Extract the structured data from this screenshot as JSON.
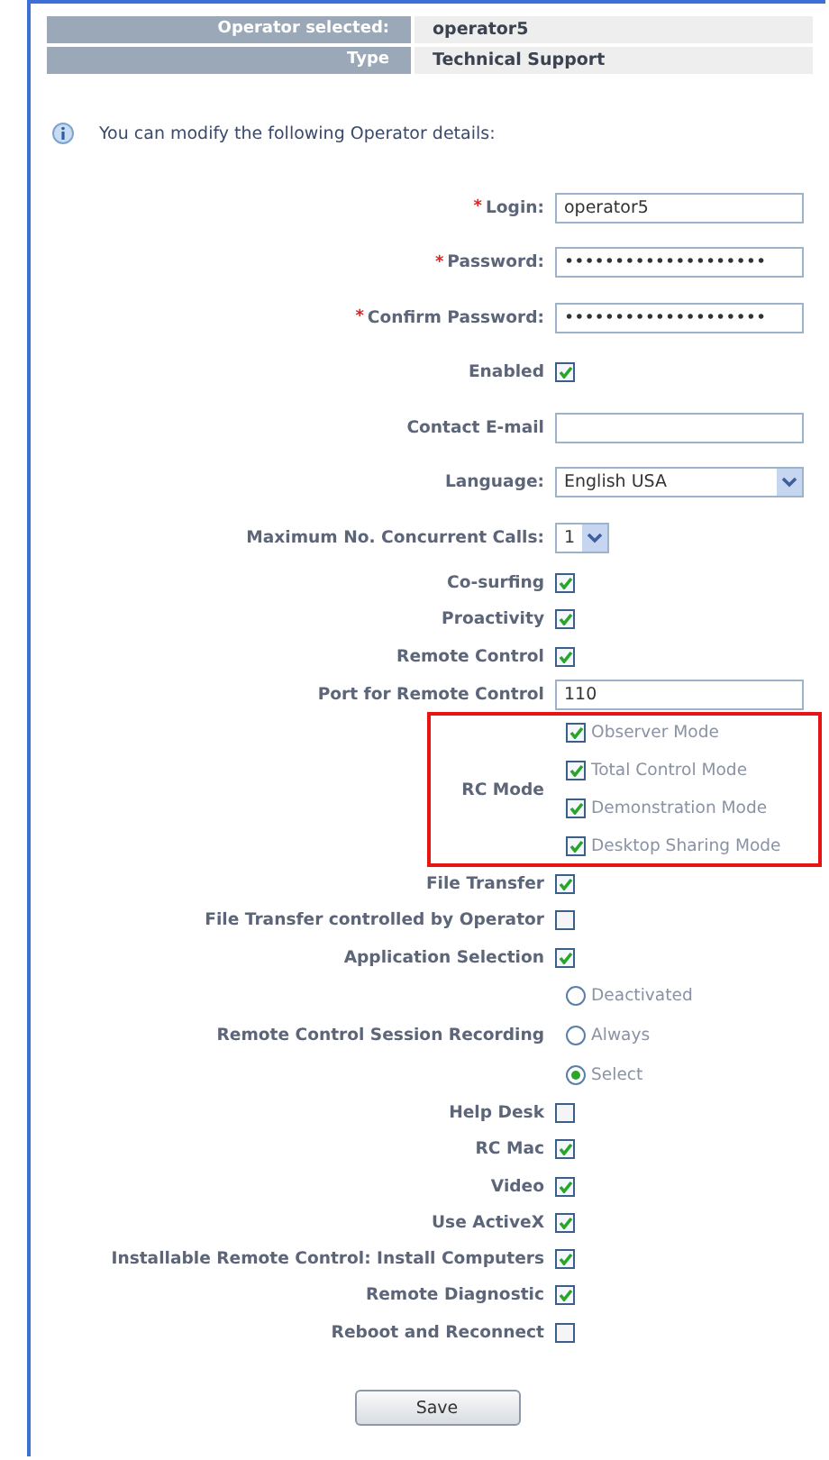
{
  "header": [
    {
      "label": "Operator selected:",
      "value": "operator5"
    },
    {
      "label": "Type",
      "value": "Technical Support"
    }
  ],
  "info": "You can modify the following Operator details:",
  "account_fields": [
    {
      "kind": "text",
      "required_mark": "*",
      "label": "Login:",
      "value": "operator5"
    },
    {
      "kind": "text",
      "required_mark": "*",
      "label": "Password:",
      "value": "••••••••••••••••••••"
    },
    {
      "kind": "text",
      "required_mark": "*",
      "label": "Confirm Password:",
      "value": "••••••••••••••••••••"
    },
    {
      "kind": "checkbox",
      "label": "Enabled",
      "checked": true
    },
    {
      "kind": "text",
      "label": "Contact E-mail"
    },
    {
      "kind": "select",
      "label": "Language:",
      "value": "English USA",
      "wide": true
    },
    {
      "kind": "select",
      "label": "Maximum No. Concurrent Calls:",
      "value": "1",
      "wide": false
    }
  ],
  "features": [
    {
      "kind": "checkbox",
      "label": "Co-surfing",
      "checked": true
    },
    {
      "kind": "checkbox",
      "label": "Proactivity",
      "checked": true
    },
    {
      "kind": "checkbox",
      "label": "Remote Control",
      "checked": true
    },
    {
      "kind": "text",
      "label": "Port for Remote Control",
      "value": "110"
    },
    {
      "kind": "checkgroup",
      "label": "RC Mode",
      "highlighted": true,
      "options": [
        {
          "label": "Observer Mode",
          "checked": true
        },
        {
          "label": "Total Control Mode",
          "checked": true
        },
        {
          "label": "Demonstration Mode",
          "checked": true
        },
        {
          "label": "Desktop Sharing Mode",
          "checked": true
        }
      ]
    },
    {
      "kind": "checkbox",
      "label": "File Transfer",
      "checked": true
    },
    {
      "kind": "checkbox",
      "label": "File Transfer controlled by Operator",
      "checked": false
    },
    {
      "kind": "checkbox",
      "label": "Application Selection",
      "checked": true
    },
    {
      "kind": "radiogroup",
      "label": "Remote Control Session Recording",
      "options": [
        {
          "label": "Deactivated",
          "selected": false
        },
        {
          "label": "Always",
          "selected": false
        },
        {
          "label": "Select",
          "selected": true
        }
      ]
    },
    {
      "kind": "checkbox",
      "label": "Help Desk",
      "checked": false
    },
    {
      "kind": "checkbox",
      "label": "RC Mac",
      "checked": true
    },
    {
      "kind": "checkbox",
      "label": "Video",
      "checked": true
    },
    {
      "kind": "checkbox",
      "label": "Use ActiveX",
      "checked": true
    },
    {
      "kind": "checkbox",
      "label": "Installable Remote Control: Install Computers",
      "checked": true
    },
    {
      "kind": "checkbox",
      "label": "Remote Diagnostic",
      "checked": true
    },
    {
      "kind": "checkbox",
      "label": "Reboot and Reconnect",
      "checked": false
    }
  ],
  "save_button": "Save"
}
